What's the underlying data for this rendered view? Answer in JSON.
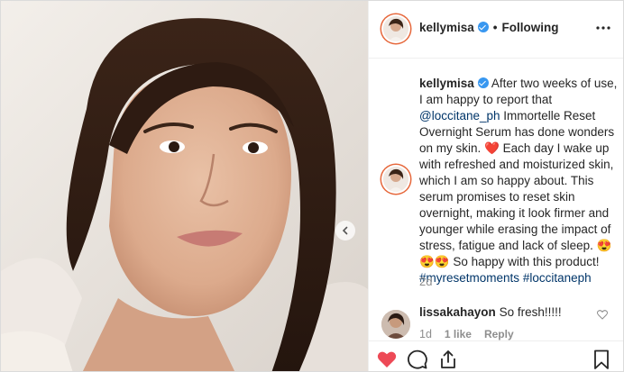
{
  "post": {
    "username": "kellymisa",
    "separator": "•",
    "follow_status": "Following",
    "caption_parts": [
      "After two weeks of use, I am happy to report that ",
      "@loccitane_ph",
      " Immortelle Reset Overnight Serum has done wonders on my skin. ❤️ Each day I wake up with refreshed and moisturized skin, which I am so happy about. This serum promises to reset skin overnight, making it look firmer and younger while erasing the impact of stress, fatigue and lack of sleep. 😍😍😍 So happy with this product! ",
      "#myresetmoments",
      " ",
      "#loccitaneph"
    ],
    "time_ago": "2d"
  },
  "comment": {
    "username": "lissakahayon",
    "text": "So fresh!!!!!",
    "time": "1d",
    "likes": "1 like",
    "reply": "Reply"
  },
  "icons": {
    "like": "heart-icon-filled",
    "comment": "comment-icon",
    "share": "share-icon",
    "save": "bookmark-icon",
    "more": "more-options-icon",
    "prev": "chevron-left-icon"
  },
  "colors": {
    "liked": "#ed4956",
    "verified": "#3897f0",
    "link": "#003569"
  }
}
